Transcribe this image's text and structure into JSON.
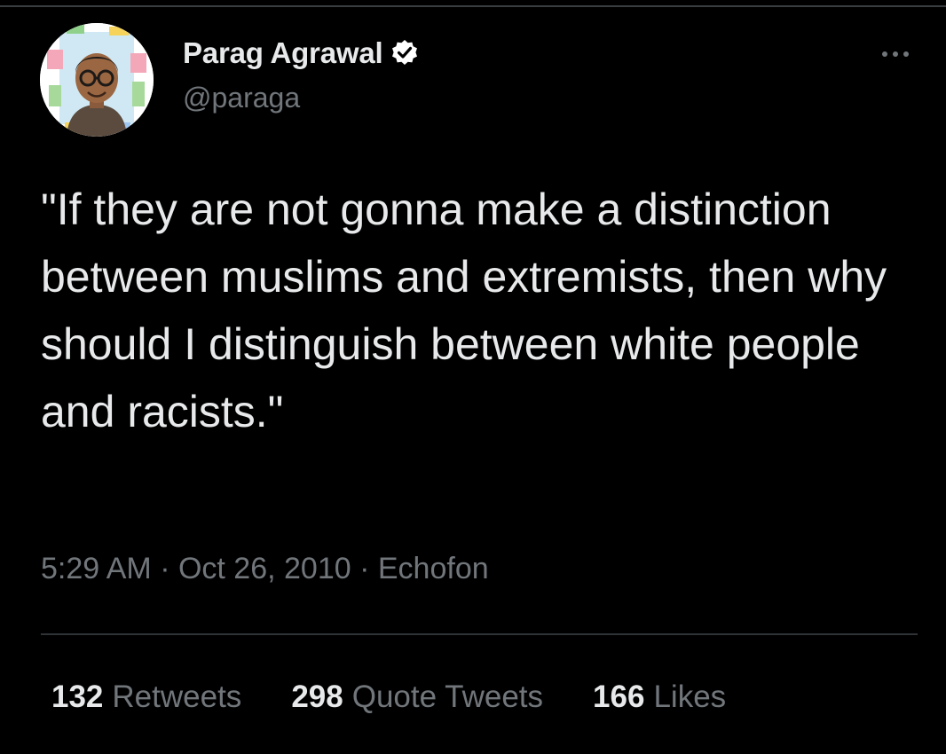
{
  "author": {
    "display_name": "Parag Agrawal",
    "handle": "@paraga",
    "verified": true,
    "avatar_icon": "cartoon-avatar"
  },
  "menu_icon": "more-horizontal-icon",
  "tweet": {
    "text": "\"If they are not gonna make a distinction between muslims and extremists, then why should I distinguish between white people and racists.\""
  },
  "meta": {
    "time": "5:29 AM",
    "separator": " · ",
    "date": "Oct 26, 2010",
    "source": "Echofon"
  },
  "stats": [
    {
      "count": "132",
      "label": "Retweets"
    },
    {
      "count": "298",
      "label": "Quote Tweets"
    },
    {
      "count": "166",
      "label": "Likes"
    }
  ],
  "colors": {
    "background": "#000000",
    "primary_text": "#e7e9ea",
    "secondary_text": "#71767b",
    "divider": "#2f3336",
    "verified_badge": "#ffffff"
  }
}
